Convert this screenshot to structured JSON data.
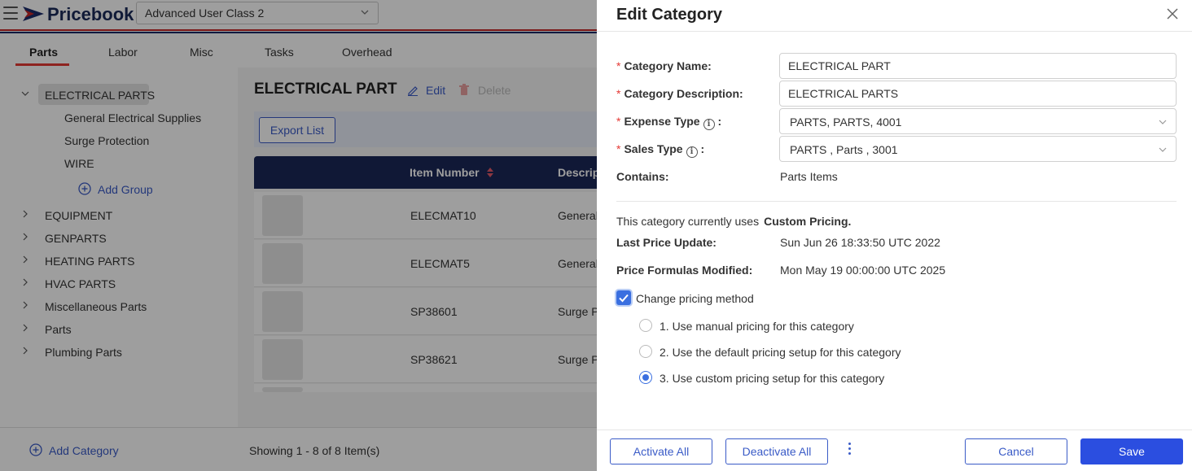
{
  "app": {
    "title": "Pricebook",
    "account_select": "Advanced User Class 2"
  },
  "tabs": [
    "Parts",
    "Labor",
    "Misc",
    "Tasks",
    "Overhead"
  ],
  "tree": {
    "selected": "ELECTRICAL PARTS",
    "children": [
      "General Electrical Supplies",
      "Surge Protection",
      "WIRE"
    ],
    "add_group": "Add Group",
    "categories": [
      "EQUIPMENT",
      "GENPARTS",
      "HEATING PARTS",
      "HVAC PARTS",
      "Miscellaneous Parts",
      "Parts",
      "Plumbing Parts"
    ],
    "add_category": "Add Category"
  },
  "main": {
    "title": "ELECTRICAL PART",
    "edit": "Edit",
    "delete": "Delete",
    "export": "Export List",
    "columns": {
      "item_number": "Item Number",
      "description": "Descrip"
    },
    "rows": [
      {
        "item": "ELECMAT10",
        "desc": "General"
      },
      {
        "item": "ELECMAT5",
        "desc": "General"
      },
      {
        "item": "SP38601",
        "desc": "Surge P"
      },
      {
        "item": "SP38621",
        "desc": "Surge P"
      }
    ],
    "showing": "Showing 1 - 8 of 8 Item(s)"
  },
  "drawer": {
    "title": "Edit Category",
    "fields": {
      "category_name": {
        "label": "Category Name",
        "value": "ELECTRICAL PART"
      },
      "category_description": {
        "label": "Category Description",
        "value": "ELECTRICAL PARTS"
      },
      "expense_type": {
        "label": "Expense Type",
        "value": "PARTS, PARTS, 4001"
      },
      "sales_type": {
        "label": "Sales Type",
        "value": "PARTS , Parts , 3001"
      },
      "contains": {
        "label": "Contains",
        "value": "Parts Items"
      }
    },
    "pricing_info_prefix": "This category currently uses",
    "pricing_info_value": "Custom Pricing.",
    "last_price_update": {
      "label": "Last Price Update",
      "value": "Sun Jun 26 18:33:50 UTC 2022"
    },
    "formulas_modified": {
      "label": "Price Formulas Modified",
      "value": "Mon May 19 00:00:00 UTC 2025"
    },
    "change_pricing_label": "Change pricing method",
    "change_pricing_checked": true,
    "options": [
      {
        "label": "1.  Use manual pricing for this category",
        "selected": false
      },
      {
        "label": "2.  Use the default pricing setup for this category",
        "selected": false
      },
      {
        "label": "3.  Use custom pricing setup for this category",
        "selected": true
      }
    ],
    "buttons": {
      "activate_all": "Activate All",
      "deactivate_all": "Deactivate All",
      "cancel": "Cancel",
      "save": "Save"
    }
  },
  "colors": {
    "accent": "#2b4ee0",
    "header_navy": "#1b2757",
    "required": "#e53935"
  }
}
